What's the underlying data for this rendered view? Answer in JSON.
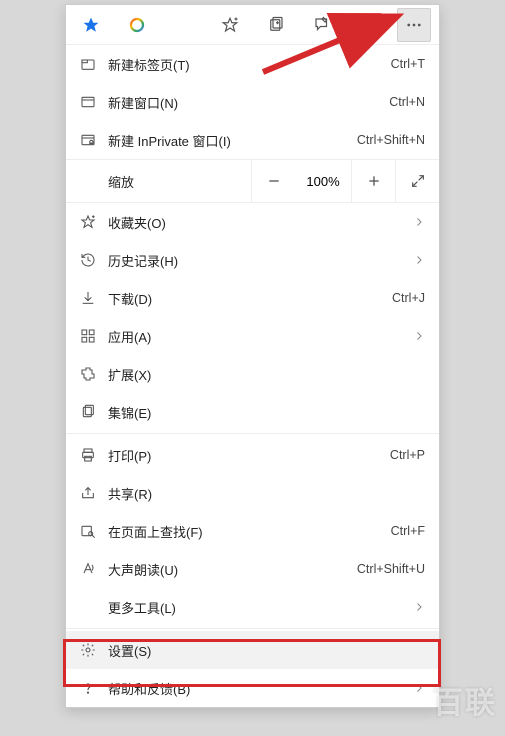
{
  "toolbar": {
    "star": "★",
    "spectrum": "◯",
    "fav_add": "⩸",
    "collections": "⧉",
    "feedback": "✎",
    "profile": "◯",
    "more": "⋯"
  },
  "menu": {
    "new_tab": {
      "label": "新建标签页(T)",
      "shortcut": "Ctrl+T"
    },
    "new_window": {
      "label": "新建窗口(N)",
      "shortcut": "Ctrl+N"
    },
    "new_inprivate": {
      "label": "新建 InPrivate 窗口(I)",
      "shortcut": "Ctrl+Shift+N"
    },
    "zoom": {
      "label": "缩放",
      "value": "100%"
    },
    "favorites": {
      "label": "收藏夹(O)"
    },
    "history": {
      "label": "历史记录(H)"
    },
    "downloads": {
      "label": "下载(D)",
      "shortcut": "Ctrl+J"
    },
    "apps": {
      "label": "应用(A)"
    },
    "extensions": {
      "label": "扩展(X)"
    },
    "collections": {
      "label": "集锦(E)"
    },
    "print": {
      "label": "打印(P)",
      "shortcut": "Ctrl+P"
    },
    "share": {
      "label": "共享(R)"
    },
    "find": {
      "label": "在页面上查找(F)",
      "shortcut": "Ctrl+F"
    },
    "read_aloud": {
      "label": "大声朗读(U)",
      "shortcut": "Ctrl+Shift+U"
    },
    "more_tools": {
      "label": "更多工具(L)"
    },
    "settings": {
      "label": "设置(S)"
    },
    "help": {
      "label": "帮助和反馈(B)"
    }
  },
  "watermark": "百联"
}
